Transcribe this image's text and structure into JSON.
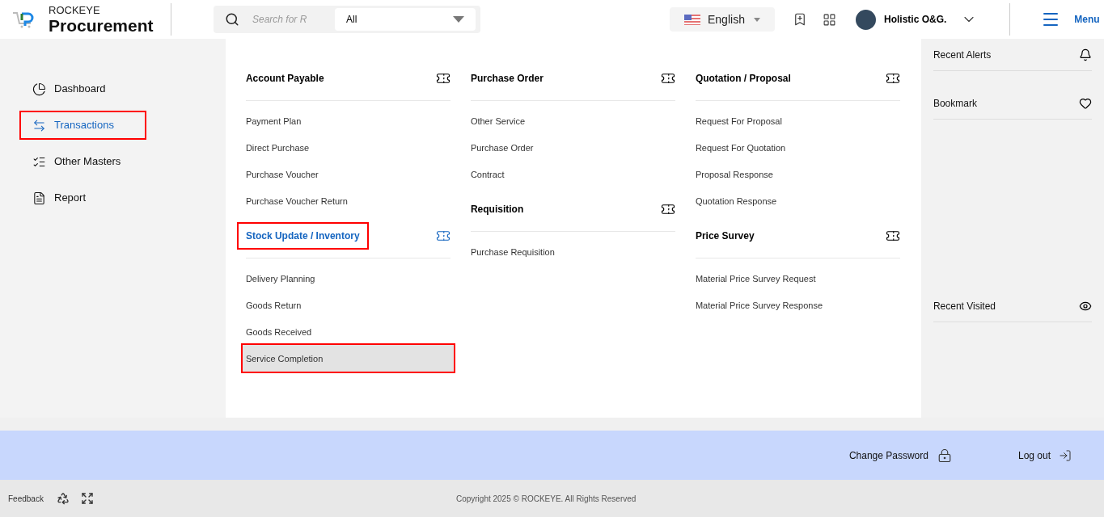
{
  "brand": {
    "top": "ROCKEYE",
    "name": "Procurement"
  },
  "search": {
    "placeholder": "Search for R",
    "scope": "All"
  },
  "language": "English",
  "user": "Holistic O&G.",
  "menu_label": "Menu",
  "sidebar": [
    {
      "label": "Dashboard",
      "selected": false,
      "highlighted": false
    },
    {
      "label": "Transactions",
      "selected": true,
      "highlighted": true
    },
    {
      "label": "Other Masters",
      "selected": false,
      "highlighted": false
    },
    {
      "label": "Report",
      "selected": false,
      "highlighted": false
    }
  ],
  "columns": [
    [
      {
        "title": "Account Payable",
        "selected": false,
        "highlighted": false,
        "items": [
          {
            "label": "Payment Plan",
            "selected": false,
            "highlighted": false
          },
          {
            "label": "Direct Purchase",
            "selected": false,
            "highlighted": false
          },
          {
            "label": "Purchase Voucher",
            "selected": false,
            "highlighted": false
          },
          {
            "label": "Purchase Voucher Return",
            "selected": false,
            "highlighted": false
          }
        ]
      },
      {
        "title": "Stock Update / Inventory",
        "selected": true,
        "highlighted": true,
        "items": [
          {
            "label": "Delivery Planning",
            "selected": false,
            "highlighted": false
          },
          {
            "label": "Goods Return",
            "selected": false,
            "highlighted": false
          },
          {
            "label": "Goods Received",
            "selected": false,
            "highlighted": false
          },
          {
            "label": "Service Completion",
            "selected": true,
            "highlighted": true
          }
        ]
      }
    ],
    [
      {
        "title": "Purchase Order",
        "selected": false,
        "highlighted": false,
        "items": [
          {
            "label": "Other Service",
            "selected": false,
            "highlighted": false
          },
          {
            "label": "Purchase Order",
            "selected": false,
            "highlighted": false
          },
          {
            "label": "Contract",
            "selected": false,
            "highlighted": false
          }
        ]
      },
      {
        "title": "Requisition",
        "selected": false,
        "highlighted": false,
        "items": [
          {
            "label": "Purchase Requisition",
            "selected": false,
            "highlighted": false
          }
        ]
      }
    ],
    [
      {
        "title": "Quotation / Proposal",
        "selected": false,
        "highlighted": false,
        "items": [
          {
            "label": "Request For Proposal",
            "selected": false,
            "highlighted": false
          },
          {
            "label": "Request For Quotation",
            "selected": false,
            "highlighted": false
          },
          {
            "label": "Proposal Response",
            "selected": false,
            "highlighted": false
          },
          {
            "label": "Quotation Response",
            "selected": false,
            "highlighted": false
          }
        ]
      },
      {
        "title": "Price Survey",
        "selected": false,
        "highlighted": false,
        "items": [
          {
            "label": "Material Price Survey Request",
            "selected": false,
            "highlighted": false
          },
          {
            "label": "Material Price Survey Response",
            "selected": false,
            "highlighted": false
          }
        ]
      }
    ]
  ],
  "panel": [
    {
      "kind": "alerts",
      "label": "Recent Alerts"
    },
    {
      "kind": "bookmark",
      "label": "Bookmark"
    },
    {
      "kind": "visited",
      "label": "Recent Visited"
    }
  ],
  "account_bar": {
    "change_password": "Change Password",
    "logout": "Log out"
  },
  "footer": {
    "feedback": "Feedback",
    "copyright": "Copyright 2025 © ROCKEYE. All Rights Reserved"
  }
}
